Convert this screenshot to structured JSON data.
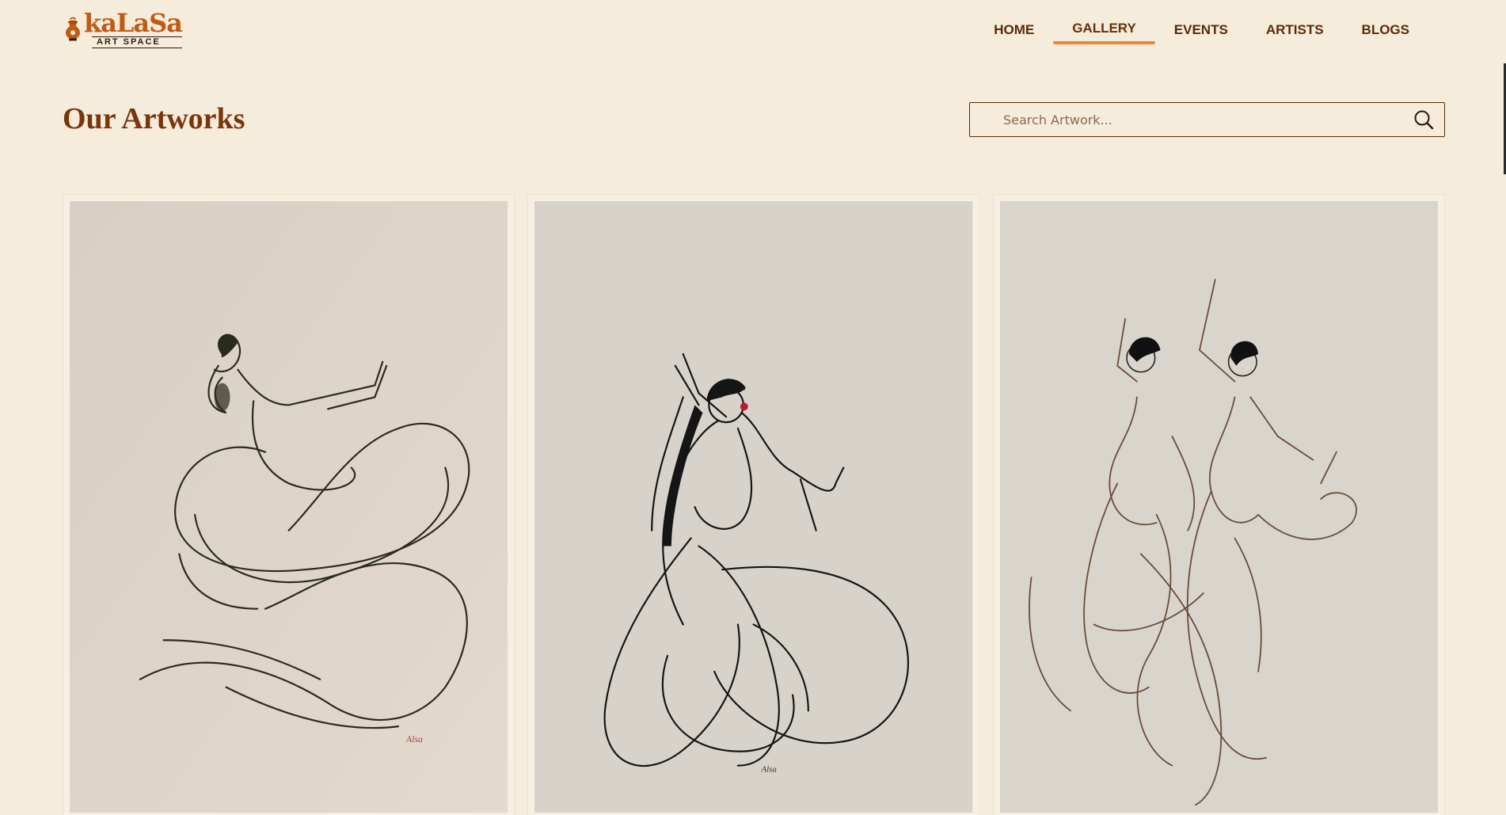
{
  "header": {
    "logo": {
      "brand": "kaLaSa",
      "sub": "ART SPACE"
    },
    "nav": [
      {
        "label": "HOME",
        "active": false
      },
      {
        "label": "GALLERY",
        "active": true
      },
      {
        "label": "EVENTS",
        "active": false
      },
      {
        "label": "ARTISTS",
        "active": false
      },
      {
        "label": "BLOGS",
        "active": false
      }
    ]
  },
  "main": {
    "title": "Our Artworks",
    "search": {
      "placeholder": "Search Artwork...",
      "icon": "search-icon"
    },
    "artworks": [
      {
        "subject": "single dancer line sketch"
      },
      {
        "subject": "dancer with braid line sketch"
      },
      {
        "subject": "two dancers line sketch"
      }
    ]
  },
  "colors": {
    "background": "#f5ecdc",
    "accent": "#ea8a3d",
    "brand": "#c15a12",
    "text": "#5b2a08"
  }
}
